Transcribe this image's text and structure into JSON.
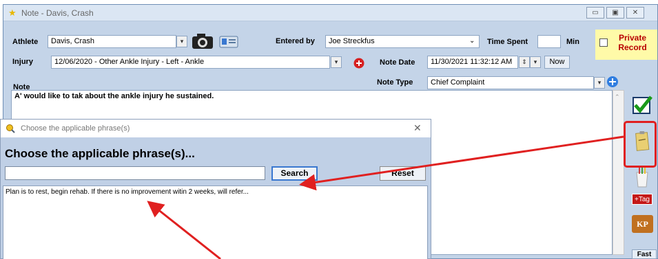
{
  "window": {
    "title": "Note - Davis, Crash"
  },
  "form": {
    "athlete_label": "Athlete",
    "athlete_value": "Davis, Crash",
    "entered_by_label": "Entered by",
    "entered_by_value": "Joe Streckfus",
    "time_spent_label": "Time Spent",
    "time_spent_value": "",
    "time_unit": "Min",
    "private_record_label": "Private Record",
    "injury_label": "Injury",
    "injury_value": "12/06/2020 - Other Ankle Injury - Left - Ankle",
    "note_date_label": "Note Date",
    "note_date_value": "11/30/2021 11:32:12 AM",
    "now_button": "Now",
    "note_type_label": "Note Type",
    "note_type_value": "Chief Complaint",
    "note_label": "Note",
    "note_text": "A' would like to tak about the ankle injury he sustained."
  },
  "right_toolbar": {
    "tag_label": "+Tag",
    "kp_label": "KP",
    "bottom_label": "Fast"
  },
  "dialog": {
    "title": "Choose the applicable phrase(s)",
    "heading": "Choose the applicable phrase(s)...",
    "search_value": "",
    "search_button": "Search",
    "reset_button": "Reset",
    "items": [
      "Plan is to rest, begin rehab.  If there is no improvement witin 2 weeks, will refer..."
    ]
  },
  "colors": {
    "accent": "#3a78d0",
    "annotation": "#e02020",
    "private_bg": "#fffaa8"
  }
}
